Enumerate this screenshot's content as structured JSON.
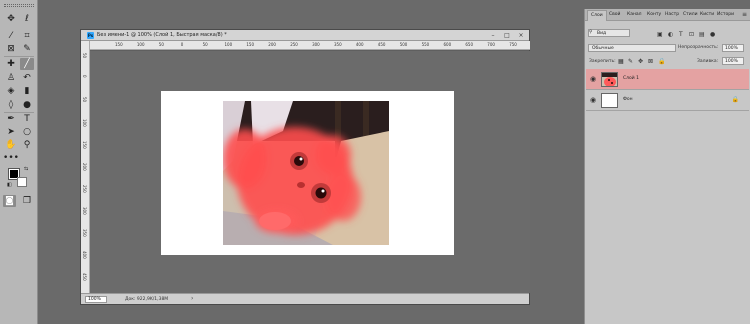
{
  "document": {
    "title": "Без имени-1 @ 100% (Слой 1, Быстрая маска/8) *",
    "app_badge": "Ps",
    "zoom": "100%",
    "info": "Док: 922,9K/1,38M",
    "ruler_h": [
      "150",
      "100",
      "50",
      "0",
      "50",
      "100",
      "150",
      "200",
      "250",
      "300",
      "350",
      "400",
      "450",
      "500",
      "550",
      "600",
      "650",
      "700",
      "750"
    ],
    "ruler_v": [
      "50",
      "0",
      "50",
      "100",
      "150",
      "200",
      "250",
      "300",
      "350",
      "400",
      "450"
    ]
  },
  "window_controls": {
    "minimize": "–",
    "restore": "□",
    "close": "×"
  },
  "toolbar": {
    "tools": [
      "move",
      "marquee",
      "lasso",
      "quick-select",
      "crop",
      "frame",
      "eyedropper",
      "brush",
      "healing",
      "stamp",
      "history-brush",
      "eraser",
      "gradient",
      "blur",
      "dodge",
      "pen",
      "type",
      "path-select",
      "shape",
      "hand",
      "zoom",
      "more"
    ],
    "more_label": "•••"
  },
  "panel": {
    "tabs": [
      "Слои",
      "Свой",
      "Канал",
      "Конту",
      "Настр",
      "Стили",
      "Кисти",
      "Истори"
    ],
    "active_tab": "Слои",
    "filter_value": "Вид",
    "blend_mode": "Обычные",
    "opacity_label": "Непрозрачность:",
    "opacity_value": "100%",
    "lock_label": "Закрепить:",
    "fill_label": "Заливка:",
    "fill_value": "100%",
    "layers": [
      {
        "name": "Слой 1",
        "selected": true
      },
      {
        "name": "Фон",
        "selected": false,
        "locked": true
      }
    ]
  },
  "colors": {
    "accent_selected_layer": "#e4a2a2",
    "quick_mask_red": "#ff4e4e"
  }
}
